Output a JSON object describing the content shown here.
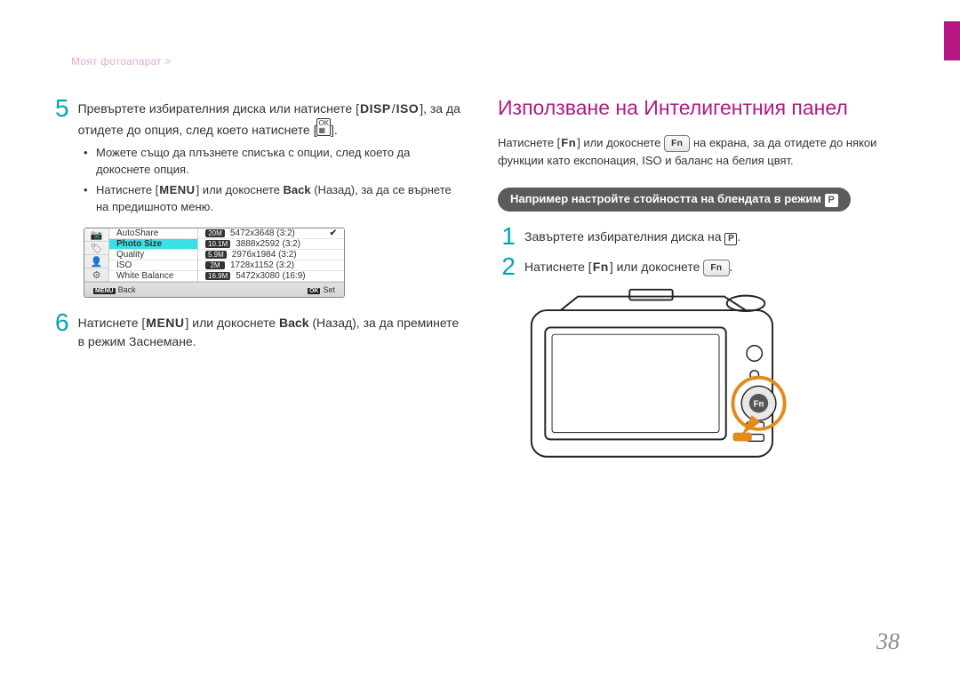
{
  "breadcrumb": "Моят фотоапарат",
  "left": {
    "step5_num": "5",
    "step5_text_a": "Превъртете избирателния диска или натиснете [",
    "step5_key_disp": "DISP",
    "step5_slash": "/",
    "step5_key_iso": "ISO",
    "step5_text_b": "], за да отидете до опция, след което натиснете [",
    "step5_text_c": "].",
    "sub1_a": "Можете също да плъзнете списъка с опции, след което да докоснете опция.",
    "sub2_a": "Натиснете [",
    "sub2_menu": "MENU",
    "sub2_b": "] или докоснете ",
    "sub2_back": "Back",
    "sub2_c": " (Назад), за да се върнете на предишното меню.",
    "step6_num": "6",
    "step6_a": "Натиснете [",
    "step6_menu": "MENU",
    "step6_b": "] или докоснете ",
    "step6_back": "Back",
    "step6_c": " (Назад), за да преминете в режим Заснемане."
  },
  "lcd": {
    "side": [
      "📷",
      "🏷",
      "👤",
      "⚙"
    ],
    "mid": [
      "AutoShare",
      "Photo Size",
      "Quality",
      "ISO",
      "White Balance"
    ],
    "mid_selected": 1,
    "rows": [
      {
        "pill": "20M",
        "label": "5472x3648 (3:2)",
        "check": true
      },
      {
        "pill": "10.1M",
        "label": "3888x2592 (3:2)"
      },
      {
        "pill": "5.9M",
        "label": "2976x1984 (3:2)"
      },
      {
        "pill": "2M",
        "label": "1728x1152 (3:2)"
      },
      {
        "pill": "16.9M",
        "label": "5472x3080 (16:9)"
      }
    ],
    "foot_left_key": "MENU",
    "foot_left": "Back",
    "foot_right_key": "OK",
    "foot_right": "Set"
  },
  "right": {
    "heading": "Използване на Интелигентния панел",
    "para_a": "Натиснете [",
    "para_fn1": "Fn",
    "para_b": "] или докоснете ",
    "para_fnbtn": "Fn",
    "para_c": " на екрана, за да отидете до някои функции като експонация, ISO и баланс на белия цвят.",
    "pill_text": "Например настройте стойността на блендата в режим ",
    "pill_P": "P",
    "s1_num": "1",
    "s1_a": "Завъртете избирателния диска на ",
    "s1_P": "P",
    "s1_b": ".",
    "s2_num": "2",
    "s2_a": "Натиснете [",
    "s2_fn": "Fn",
    "s2_b": "] или докоснете ",
    "s2_fnbtn": "Fn",
    "s2_c": "."
  },
  "camera_fn_label": "Fn",
  "pagenum": "38"
}
